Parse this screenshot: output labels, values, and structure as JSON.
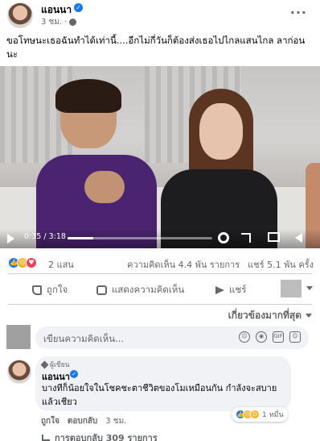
{
  "post": {
    "author": "แอนนา",
    "time": "3 ชม.",
    "more_label": "···",
    "text": "ขอโทษนะเธอฉันทำได้เท่านี้....อีกไม่กี่วันก็ต้องส่งเธอไปไกลแสนไกล ลาก่อนนะ"
  },
  "video": {
    "current_time": "0:35",
    "duration": "3:18",
    "time_display": "0:35 / 3:18",
    "progress_fraction": 0.177
  },
  "reactions": {
    "icons": [
      "like-icon",
      "sad-icon",
      "love-icon"
    ],
    "count": "2 แสน",
    "comments": "ความคิดเห็น 4.4 พัน รายการ",
    "shares": "แชร์ 5.1 พัน ครั้ง"
  },
  "actions": {
    "like": "ถูกใจ",
    "comment": "แสดงความคิดเห็น",
    "share": "แชร์"
  },
  "sort": {
    "label": "เกี่ยวข้องมากที่สุด"
  },
  "composer": {
    "placeholder": "เขียนความคิดเห็น..."
  },
  "comment": {
    "badge": "ผู้เขียน",
    "author": "แอนนา",
    "text": "บางทีก็น้อยใจในโชคชะตาชีวิตของโมเหมือนกัน กำลังจะสบายแล้วเชียว",
    "like_label": "ถูกใจ",
    "reply_label": "ตอบกลับ",
    "time": "3 ชม.",
    "reaction_count": "1 หมื่น",
    "view_replies": "การตอบกลับ 309 รายการ"
  },
  "colors": {
    "accent": "#1877f2",
    "secondary_text": "#65676b",
    "bubble_bg": "#f0f2f5"
  }
}
